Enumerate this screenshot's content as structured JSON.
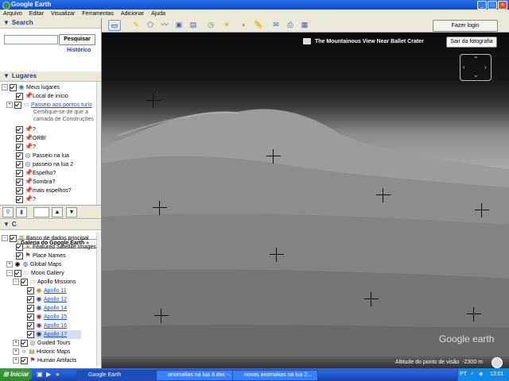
{
  "window": {
    "title": "Google Earth",
    "icon": "google-earth-icon"
  },
  "menu": [
    "Arquivo",
    "Editar",
    "Visualizar",
    "Ferramentas",
    "Adicionar",
    "Ajuda"
  ],
  "toolbar": {
    "login_label": "Fazer login"
  },
  "search": {
    "header": "Search",
    "placeholder": "",
    "button": "Pesquisar",
    "history": "Histórico"
  },
  "places": {
    "header": "Lugares",
    "items": [
      {
        "label": "Meus lugares",
        "checked": true,
        "icon": "globe-icon",
        "expander": "−"
      },
      {
        "label": "Local de início",
        "checked": true,
        "icon": "pushpin-icon"
      },
      {
        "label": "Passeio aos pontos turís",
        "checked": true,
        "icon": "folder-icon",
        "link": true,
        "expander": "+"
      },
      {
        "label": "Certifique-se de que a",
        "note": true
      },
      {
        "label": "camada de Construções",
        "note": true
      },
      {
        "label": "?",
        "checked": true,
        "icon": "pushpin-icon"
      },
      {
        "label": "ORB!",
        "checked": true,
        "icon": "pushpin-icon"
      },
      {
        "label": "?",
        "checked": true,
        "icon": "pushpin-icon"
      },
      {
        "label": "Passeio na lua",
        "checked": true,
        "icon": "tour-icon"
      },
      {
        "label": "passeio na lua 2",
        "checked": true,
        "icon": "tour-icon"
      },
      {
        "label": "Espelho?",
        "checked": true,
        "icon": "pushpin-icon"
      },
      {
        "label": "Sombra?",
        "checked": true,
        "icon": "pushpin-icon"
      },
      {
        "label": "mais espelhos?",
        "checked": true,
        "icon": "pushpin-icon"
      },
      {
        "label": "?",
        "checked": true,
        "icon": "pushpin-icon"
      }
    ]
  },
  "layers": {
    "header": "C",
    "gallery_button": "Galeria do Google Earth",
    "items": [
      {
        "label": "Banco de dados principal",
        "checked": true,
        "icon": "database-icon",
        "expander": "−",
        "level": 0
      },
      {
        "label": "Featured Satellite Images",
        "checked": true,
        "icon": "satellite-icon",
        "level": 1
      },
      {
        "label": "Place Names",
        "checked": true,
        "icon": "flag-icon",
        "level": 1
      },
      {
        "label": "Global Maps",
        "radio": true,
        "icon": "globe-icon",
        "expander": "+",
        "level": 1
      },
      {
        "label": "Moon Gallery",
        "checked": true,
        "icon": "folder-icon",
        "expander": "−",
        "level": 1
      },
      {
        "label": "Apollo Missions",
        "checked": true,
        "icon": "folder-icon",
        "expander": "−",
        "level": 2
      },
      {
        "label": "Apollo 11",
        "checked": true,
        "icon": "apollo-patch-icon",
        "link": true,
        "level": 3
      },
      {
        "label": "Apollo 12",
        "checked": true,
        "icon": "apollo-patch-icon",
        "link": true,
        "level": 3
      },
      {
        "label": "Apollo 14",
        "checked": true,
        "icon": "apollo-patch-icon",
        "link": true,
        "level": 3
      },
      {
        "label": "Apollo 15",
        "checked": true,
        "icon": "apollo-patch-icon",
        "link": true,
        "level": 3
      },
      {
        "label": "Apollo 16",
        "checked": true,
        "icon": "apollo-patch-icon",
        "link": true,
        "level": 3
      },
      {
        "label": "Apollo 17",
        "checked": true,
        "icon": "apollo-patch-icon",
        "link": true,
        "level": 3,
        "selected": true
      },
      {
        "label": "Guided Tours",
        "checked": true,
        "icon": "tour-icon",
        "expander": "+",
        "level": 2
      },
      {
        "label": "Historic Maps",
        "radio": true,
        "icon": "map-icon",
        "expander": "+",
        "level": 2
      },
      {
        "label": "Human Artifacts",
        "checked": true,
        "icon": "artifact-icon",
        "expander": "+",
        "level": 2
      }
    ]
  },
  "viewer": {
    "photo_title": "The Mountainous View Near Ballet Crater",
    "exit_photo": "Sair da fotografia",
    "watermark": "Google earth",
    "altitude_label": "Altitude do ponto de visão",
    "altitude_value": "-2300 m"
  },
  "taskbar": {
    "start": "Iniciar",
    "tasks": [
      {
        "label": "Google Earth",
        "active": true
      },
      {
        "label": "anomalias na lua 3.doc -...",
        "active": false
      },
      {
        "label": "novas anomalias na lua 2...",
        "active": false
      }
    ],
    "clock": "13:01",
    "language": "PT"
  },
  "colors": {
    "title_bar": "#0a4bd0",
    "link": "#1a4fcf",
    "header_text": "#1a3f8f",
    "taskbar": "#245edb",
    "start": "#2e8b2e"
  }
}
